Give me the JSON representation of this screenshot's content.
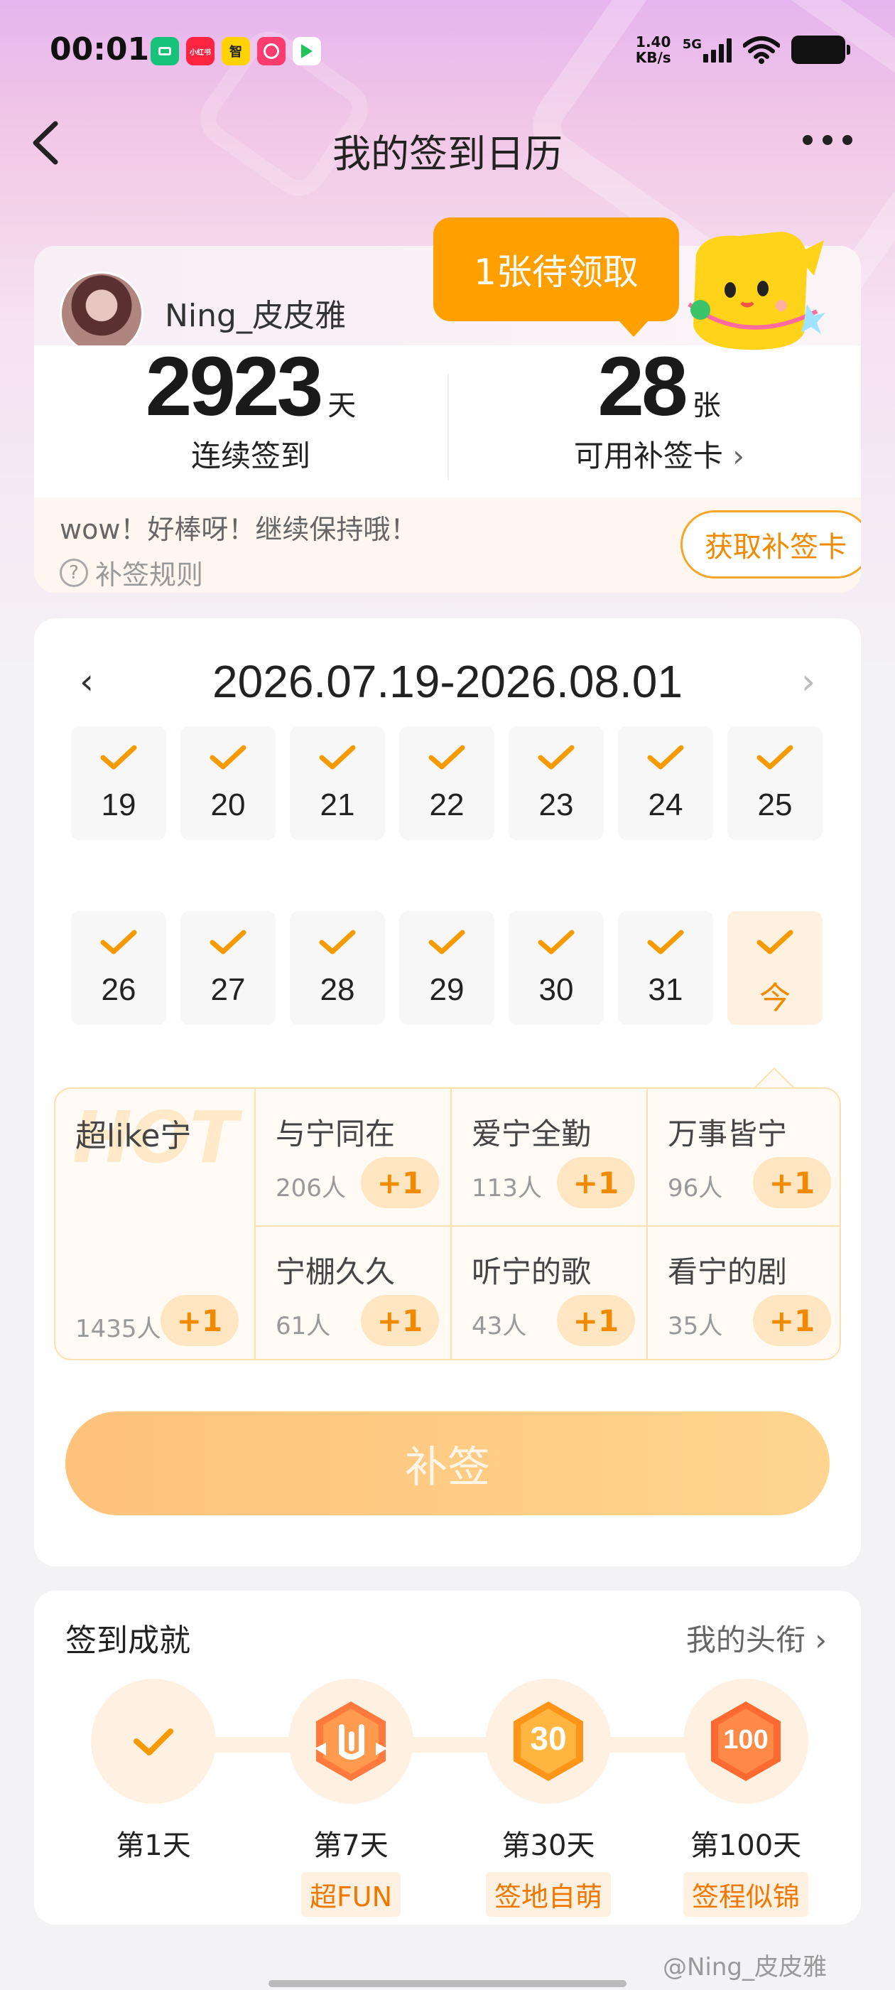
{
  "status_bar": {
    "time": "00:01",
    "net_speed_value": "1.40",
    "net_speed_unit": "KB/s",
    "network": "5G",
    "app_icons": [
      {
        "name": "green-app-icon",
        "color": "#17c27a",
        "label": ""
      },
      {
        "name": "xiaohongshu-icon",
        "color": "#ff2442",
        "label": "小红书"
      },
      {
        "name": "tencent-video-icon",
        "color": "#ffd200",
        "label": "智"
      },
      {
        "name": "pink-app-icon",
        "color": "#ff3c6f",
        "label": ""
      },
      {
        "name": "play-app-icon",
        "color": "#ffffff",
        "label": ""
      }
    ]
  },
  "nav": {
    "title": "我的签到日历"
  },
  "profile": {
    "username": "Ning_皮皮雅",
    "streak_days": "2923",
    "streak_unit": "天",
    "streak_label": "连续签到",
    "cards": "28",
    "cards_unit": "张",
    "cards_label": "可用补签卡",
    "bubble": "1张待领取",
    "encourage": "wow！好棒呀！继续保持哦！",
    "rules": "补签规则",
    "get_card_btn": "获取补签卡"
  },
  "calendar": {
    "range": "2026.07.19-2026.08.01",
    "week1": [
      "19",
      "20",
      "21",
      "22",
      "23",
      "24",
      "25"
    ],
    "week2": [
      "26",
      "27",
      "28",
      "29",
      "30",
      "31",
      "今"
    ],
    "today_index": 6,
    "accent": "#f59a00"
  },
  "groups": {
    "hot_mark": "HOT",
    "plus_label": "+1",
    "featured": {
      "name": "超like宁",
      "count": "1435人"
    },
    "cells": [
      {
        "name": "与宁同在",
        "count": "206人"
      },
      {
        "name": "爱宁全勤",
        "count": "113人"
      },
      {
        "name": "万事皆宁",
        "count": "96人"
      },
      {
        "name": "宁棚久久",
        "count": "61人"
      },
      {
        "name": "听宁的歌",
        "count": "43人"
      },
      {
        "name": "看宁的剧",
        "count": "35人"
      }
    ]
  },
  "makeup_button": "补签",
  "achievements": {
    "title": "签到成就",
    "link": "我的头衔",
    "items": [
      {
        "day": "第1天",
        "badge": ""
      },
      {
        "day": "第7天",
        "badge": "超FUN"
      },
      {
        "day": "第30天",
        "badge": "签地自萌"
      },
      {
        "day": "第100天",
        "badge": "签程似锦"
      }
    ]
  },
  "watermark": "@Ning_皮皮雅"
}
